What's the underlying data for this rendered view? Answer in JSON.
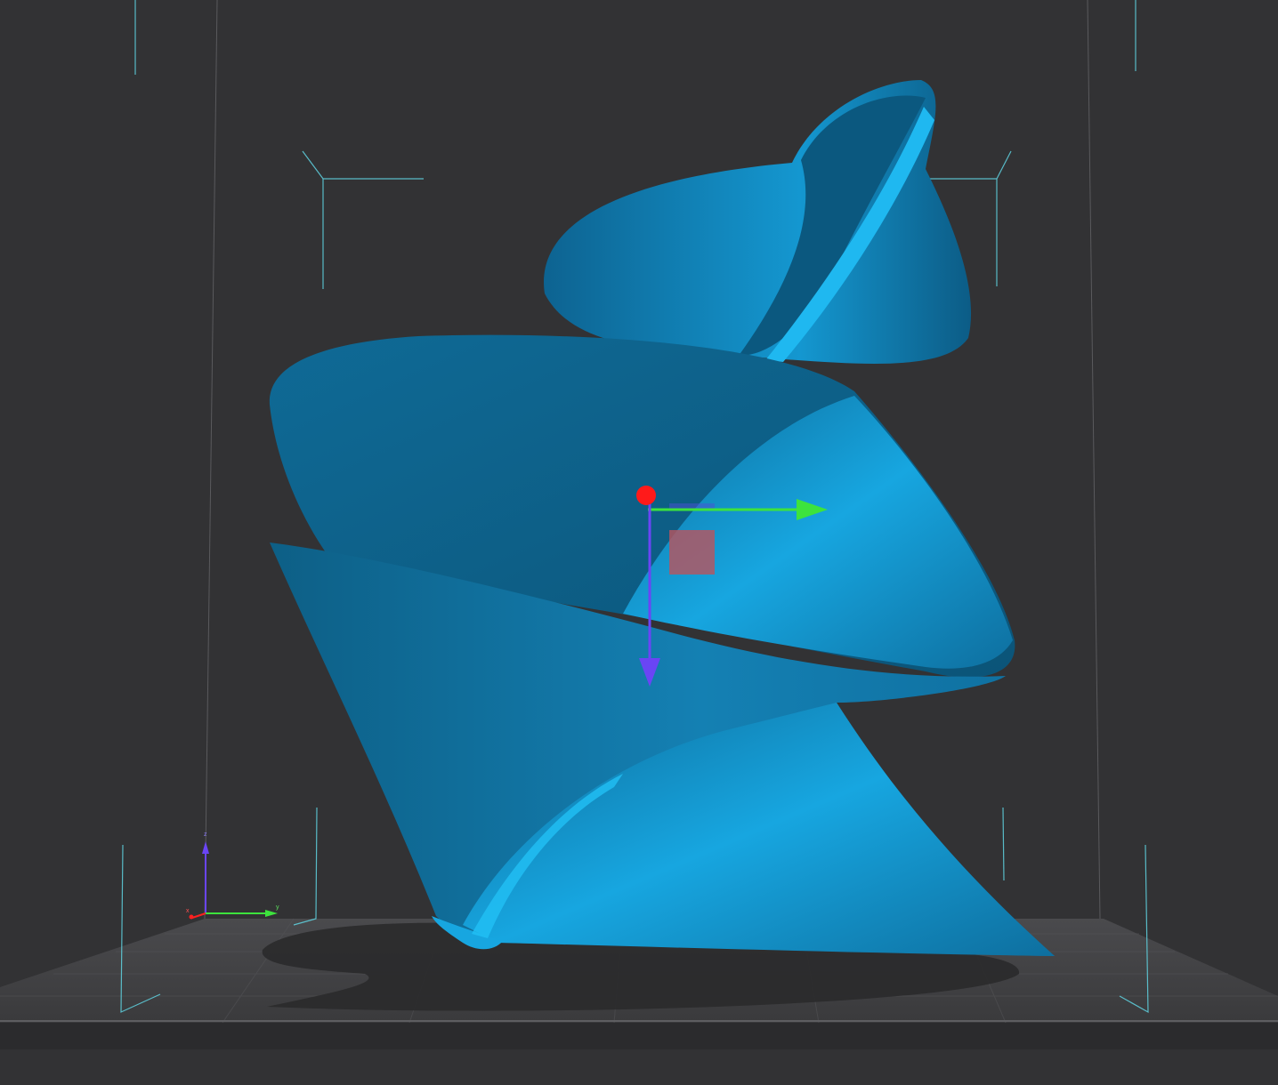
{
  "viewport": {
    "background_color": "#323234",
    "model_color": "#1a86b8",
    "model_highlight_color": "#13b4f0",
    "bed_color": "#3f3f42",
    "bounding_box_color": "#5fd3e2"
  },
  "gizmo": {
    "x_axis_color": "#3de33d",
    "z_axis_color": "#6a45f5",
    "center_handle_color": "#ff1a1a",
    "plane_handle_color": "#b9545e"
  },
  "axis_indicator": {
    "x_label": "x",
    "y_label": "y",
    "z_label": "z"
  }
}
